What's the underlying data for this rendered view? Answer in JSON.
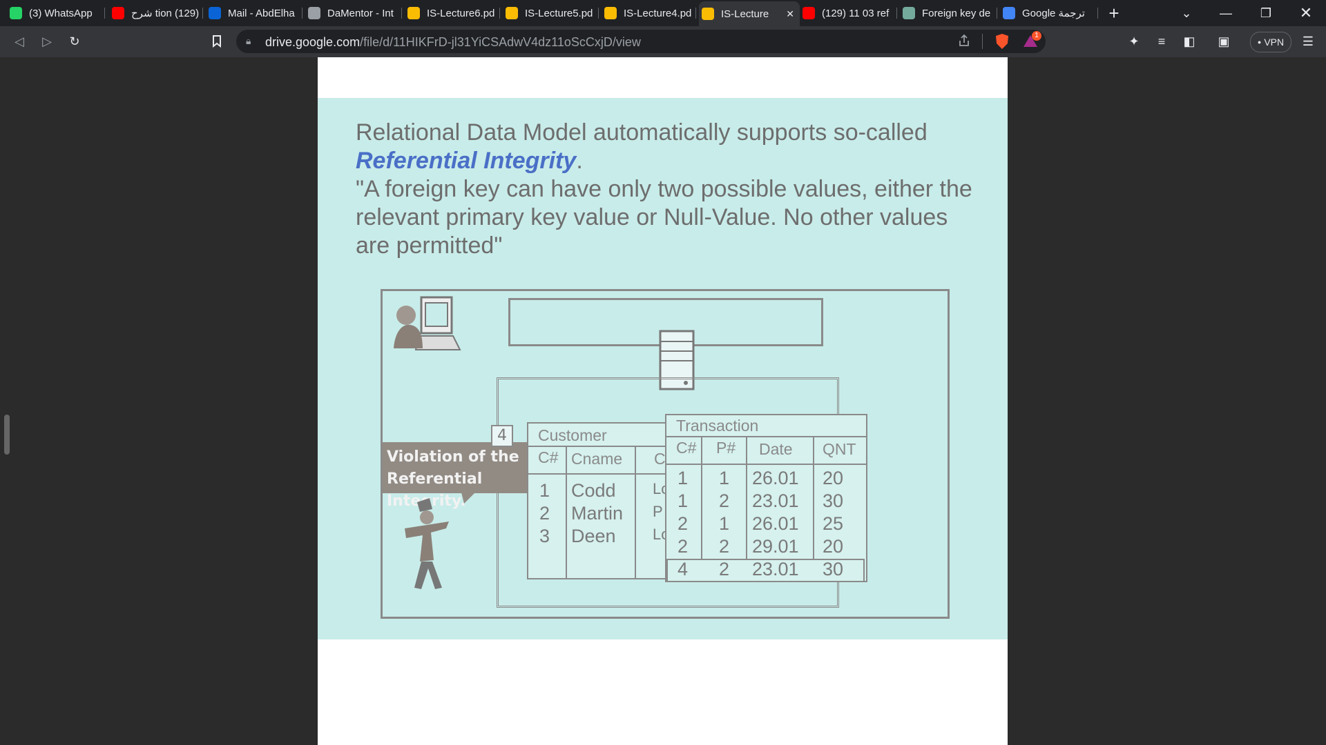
{
  "browser": {
    "tabs": [
      {
        "label": "(3) WhatsApp",
        "icon": "whatsapp-icon",
        "color": "#25d366"
      },
      {
        "label": "شرح tion (129)",
        "icon": "youtube-icon",
        "color": "#ff0000"
      },
      {
        "label": "Mail - AbdElha",
        "icon": "outlook-icon",
        "color": "#0a64d6"
      },
      {
        "label": "DaMentor - Int",
        "icon": "globe-icon",
        "color": "#9aa0a6"
      },
      {
        "label": "IS-Lecture6.pd",
        "icon": "drive-icon",
        "color": "#fbbc04"
      },
      {
        "label": "IS-Lecture5.pd",
        "icon": "drive-icon",
        "color": "#fbbc04"
      },
      {
        "label": "IS-Lecture4.pd",
        "icon": "drive-icon",
        "color": "#fbbc04"
      },
      {
        "label": "IS-Lecture",
        "icon": "drive-icon",
        "color": "#fbbc04",
        "active": true
      },
      {
        "label": "(129) 11 03 ref",
        "icon": "youtube-icon",
        "color": "#ff0000"
      },
      {
        "label": "Foreign key de",
        "icon": "chatgpt-icon",
        "color": "#74aa9c"
      },
      {
        "label": "Google ترجمة",
        "icon": "translate-icon",
        "color": "#4285f4"
      }
    ],
    "url_host": "drive.google.com",
    "url_path": "/file/d/11HIKFrD-jl31YiCSAdwV4dz11oScCxjD/view",
    "vpn_label": "VPN",
    "brave_badge": "1"
  },
  "slide": {
    "line1": "Relational Data Model automatically supports so-called",
    "emphasis": "Referential Integrity",
    "emphasis_suffix": ".",
    "quote_line1": "\"A foreign key can have only two possible values, either the",
    "quote_line2": "relevant primary key value or Null-Value. No other values",
    "quote_line3": "are permitted\"",
    "violation_line1": "Violation of the",
    "violation_line2": "Referential Integrity.",
    "badge": "4",
    "customer": {
      "title": "Customer",
      "headers": [
        "C#",
        "Cname",
        "C"
      ],
      "rows": [
        [
          "1",
          "Codd",
          "Lc"
        ],
        [
          "2",
          "Martin",
          "P"
        ],
        [
          "3",
          "Deen",
          "Lc"
        ]
      ]
    },
    "transaction": {
      "title": "Transaction",
      "headers": [
        "C#",
        "P#",
        "Date",
        "QNT"
      ],
      "rows": [
        [
          "1",
          "1",
          "26.01",
          "20"
        ],
        [
          "1",
          "2",
          "23.01",
          "30"
        ],
        [
          "2",
          "1",
          "26.01",
          "25"
        ],
        [
          "2",
          "2",
          "29.01",
          "20"
        ],
        [
          "4",
          "2",
          "23.01",
          "30"
        ]
      ]
    }
  }
}
